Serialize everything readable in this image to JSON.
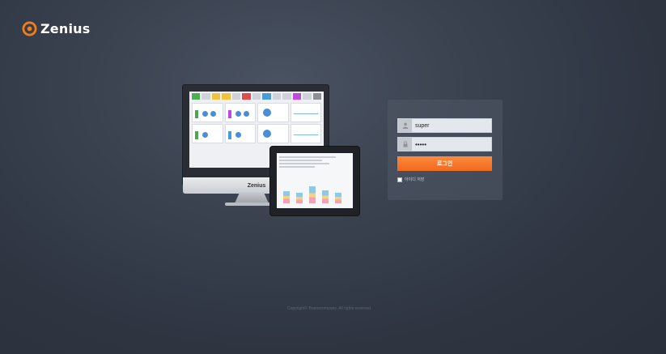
{
  "brand": {
    "name": "Zenius",
    "accent": "#f07d1d",
    "icon": "zenius-logo-icon"
  },
  "illustration": {
    "monitor_brand": "Zenius",
    "tile_colors": [
      "#4caf50",
      "#cfd3d8",
      "#f3c23c",
      "#f3c23c",
      "#cfd3d8",
      "#e24b4b",
      "#cfd3d8",
      "#4a9bd6",
      "#cfd3d8",
      "#cfd3d8",
      "#c04ae0",
      "#cfd3d8",
      "#8b8f96"
    ]
  },
  "login": {
    "username_value": "super",
    "password_value": "•••••",
    "username_icon": "user-icon",
    "password_icon": "lock-icon",
    "button_label": "로그인",
    "remember_label": "아이디 저장",
    "button_color": "#f07d1d"
  },
  "footer": {
    "copyright": "Copyright© Brainzcompany. All rights reserved."
  }
}
